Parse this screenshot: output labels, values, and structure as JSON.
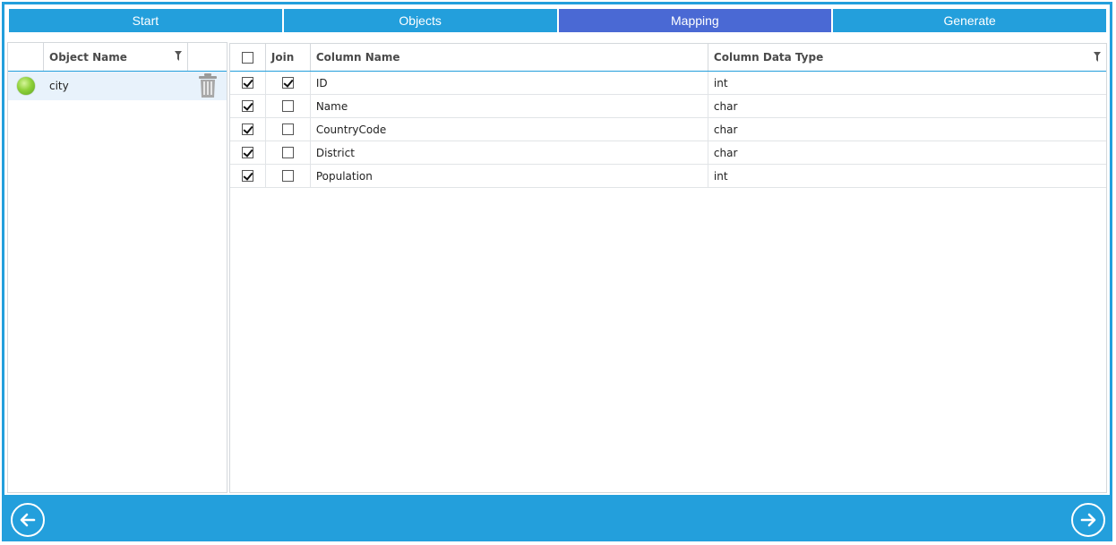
{
  "wizard": {
    "steps": [
      {
        "label": "Start",
        "active": false
      },
      {
        "label": "Objects",
        "active": false
      },
      {
        "label": "Mapping",
        "active": true
      },
      {
        "label": "Generate",
        "active": false
      }
    ]
  },
  "objects_grid": {
    "header": {
      "name": "Object Name"
    },
    "rows": [
      {
        "status": "ok",
        "name": "city"
      }
    ]
  },
  "columns_grid": {
    "header": {
      "select_all_checked": false,
      "join": "Join",
      "column_name": "Column Name",
      "column_type": "Column Data Type"
    },
    "rows": [
      {
        "selected": true,
        "join": true,
        "name": "ID",
        "type": "int"
      },
      {
        "selected": true,
        "join": false,
        "name": "Name",
        "type": "char"
      },
      {
        "selected": true,
        "join": false,
        "name": "CountryCode",
        "type": "char"
      },
      {
        "selected": true,
        "join": false,
        "name": "District",
        "type": "char"
      },
      {
        "selected": true,
        "join": false,
        "name": "Population",
        "type": "int"
      }
    ]
  },
  "footer": {
    "back_icon": "arrow-left-icon",
    "next_icon": "arrow-right-icon"
  },
  "colors": {
    "accent": "#239fdc",
    "active_step": "#4a69d4"
  }
}
